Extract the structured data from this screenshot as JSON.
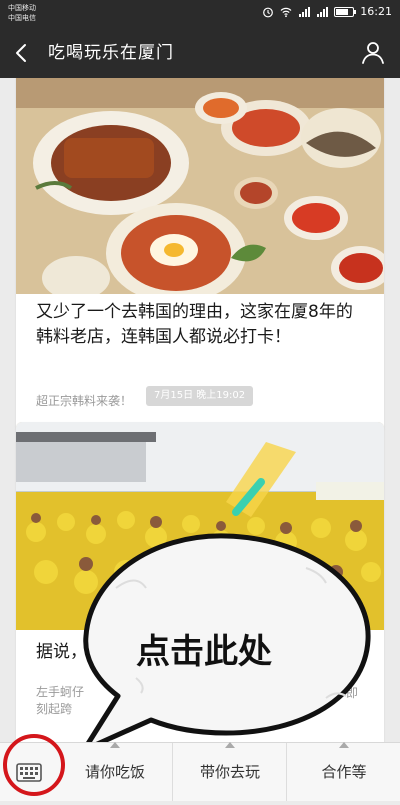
{
  "status": {
    "carrier1": "中国移动",
    "carrier2": "中国电信",
    "time": "16:21"
  },
  "header": {
    "title": "吃喝玩乐在厦门"
  },
  "feed": {
    "card1": {
      "title": "又少了一个去韩国的理由，这家在厦8年的韩料老店，连韩国人都说必打卡！",
      "subtitle": "超正宗韩料来袭！"
    },
    "timestamp": "7月15日 晚上19:02",
    "card2": {
      "title_visible": "据说，",
      "sub_line1": "左手蚵仔",
      "sub_line2": "刻起跨",
      "sub_right": "即"
    }
  },
  "overlay": {
    "bubble_text": "点击此处"
  },
  "bottom_menu": {
    "items": [
      "请你吃饭",
      "带你去玩",
      "合作等"
    ]
  }
}
